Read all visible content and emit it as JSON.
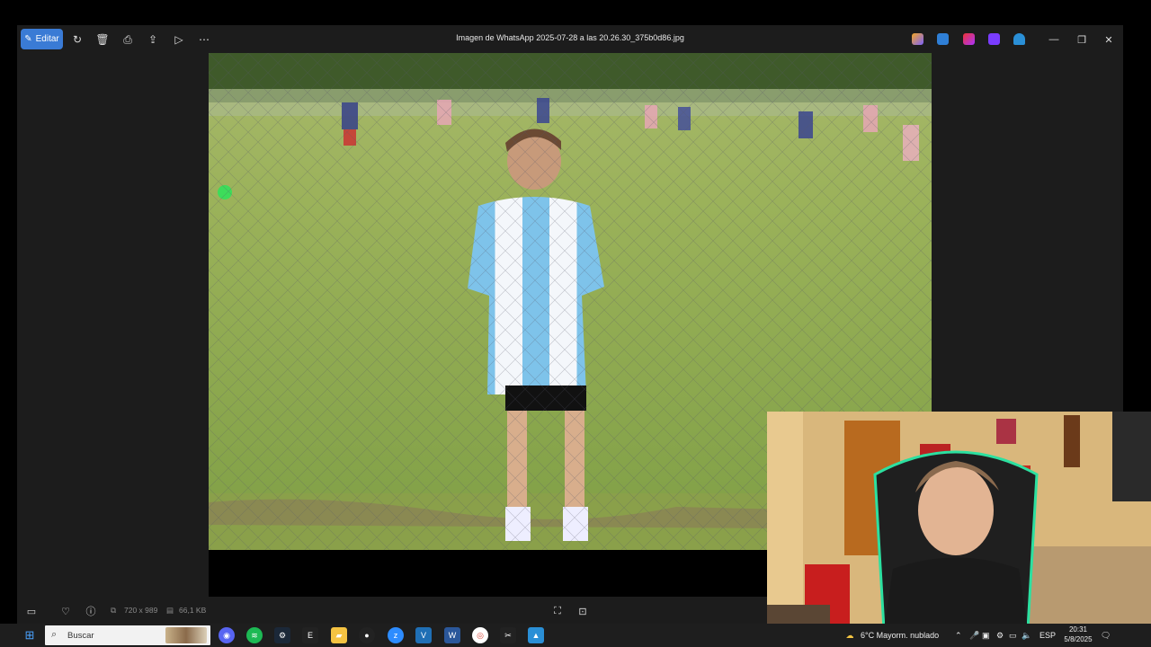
{
  "window": {
    "title": "Imagen de WhatsApp 2025-07-28 a las 20.26.30_375b0d86.jpg",
    "edit_label": "Editar"
  },
  "toolbar_icons": [
    "rotate-icon",
    "delete-icon",
    "print-icon",
    "share-icon",
    "slideshow-icon",
    "more-icon"
  ],
  "status": {
    "dimensions": "720 x 989",
    "filesize": "66,1 KB"
  },
  "taskbar": {
    "search_placeholder": "Buscar",
    "weather": "6°C  Mayorm. nublado",
    "language": "ESP",
    "time": "20:31",
    "date": "5/8/2025"
  },
  "colors": {
    "accent": "#3a7bd5",
    "window_bg": "#1c1c1c",
    "taskbar_bg": "#1e1e1e"
  }
}
